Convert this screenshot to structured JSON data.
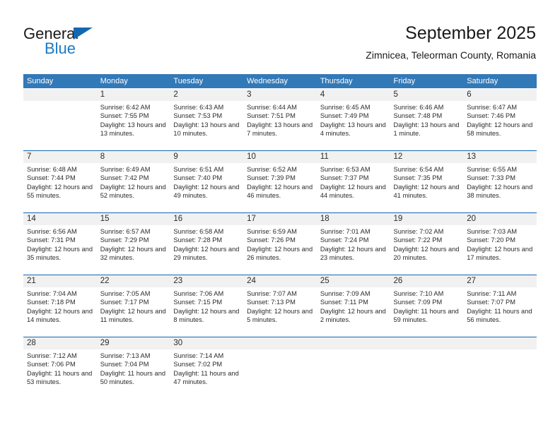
{
  "brand": {
    "name_part1": "General",
    "name_part2": "Blue",
    "triangle_color": "#1268b3",
    "blue_text_color": "#1b79c6"
  },
  "header": {
    "title": "September 2025",
    "subtitle": "Zimnicea, Teleorman County, Romania"
  },
  "theme": {
    "header_blue": "#3279b7",
    "separator_blue": "#1268b3",
    "daynum_band_gray": "#f1f1f1",
    "text_color": "#2b2b2b"
  },
  "weekday_headers": [
    "Sunday",
    "Monday",
    "Tuesday",
    "Wednesday",
    "Thursday",
    "Friday",
    "Saturday"
  ],
  "labels": {
    "sunrise_prefix": "Sunrise: ",
    "sunset_prefix": "Sunset: ",
    "daylight_prefix": "Daylight: "
  },
  "weeks": [
    {
      "days": [
        {
          "num": "",
          "sunrise": "",
          "sunset": "",
          "daylight": "",
          "empty": true
        },
        {
          "num": "1",
          "sunrise": "Sunrise: 6:42 AM",
          "sunset": "Sunset: 7:55 PM",
          "daylight": "Daylight: 13 hours and 13 minutes.",
          "empty": false
        },
        {
          "num": "2",
          "sunrise": "Sunrise: 6:43 AM",
          "sunset": "Sunset: 7:53 PM",
          "daylight": "Daylight: 13 hours and 10 minutes.",
          "empty": false
        },
        {
          "num": "3",
          "sunrise": "Sunrise: 6:44 AM",
          "sunset": "Sunset: 7:51 PM",
          "daylight": "Daylight: 13 hours and 7 minutes.",
          "empty": false
        },
        {
          "num": "4",
          "sunrise": "Sunrise: 6:45 AM",
          "sunset": "Sunset: 7:49 PM",
          "daylight": "Daylight: 13 hours and 4 minutes.",
          "empty": false
        },
        {
          "num": "5",
          "sunrise": "Sunrise: 6:46 AM",
          "sunset": "Sunset: 7:48 PM",
          "daylight": "Daylight: 13 hours and 1 minute.",
          "empty": false
        },
        {
          "num": "6",
          "sunrise": "Sunrise: 6:47 AM",
          "sunset": "Sunset: 7:46 PM",
          "daylight": "Daylight: 12 hours and 58 minutes.",
          "empty": false
        }
      ]
    },
    {
      "days": [
        {
          "num": "7",
          "sunrise": "Sunrise: 6:48 AM",
          "sunset": "Sunset: 7:44 PM",
          "daylight": "Daylight: 12 hours and 55 minutes.",
          "empty": false
        },
        {
          "num": "8",
          "sunrise": "Sunrise: 6:49 AM",
          "sunset": "Sunset: 7:42 PM",
          "daylight": "Daylight: 12 hours and 52 minutes.",
          "empty": false
        },
        {
          "num": "9",
          "sunrise": "Sunrise: 6:51 AM",
          "sunset": "Sunset: 7:40 PM",
          "daylight": "Daylight: 12 hours and 49 minutes.",
          "empty": false
        },
        {
          "num": "10",
          "sunrise": "Sunrise: 6:52 AM",
          "sunset": "Sunset: 7:39 PM",
          "daylight": "Daylight: 12 hours and 46 minutes.",
          "empty": false
        },
        {
          "num": "11",
          "sunrise": "Sunrise: 6:53 AM",
          "sunset": "Sunset: 7:37 PM",
          "daylight": "Daylight: 12 hours and 44 minutes.",
          "empty": false
        },
        {
          "num": "12",
          "sunrise": "Sunrise: 6:54 AM",
          "sunset": "Sunset: 7:35 PM",
          "daylight": "Daylight: 12 hours and 41 minutes.",
          "empty": false
        },
        {
          "num": "13",
          "sunrise": "Sunrise: 6:55 AM",
          "sunset": "Sunset: 7:33 PM",
          "daylight": "Daylight: 12 hours and 38 minutes.",
          "empty": false
        }
      ]
    },
    {
      "days": [
        {
          "num": "14",
          "sunrise": "Sunrise: 6:56 AM",
          "sunset": "Sunset: 7:31 PM",
          "daylight": "Daylight: 12 hours and 35 minutes.",
          "empty": false
        },
        {
          "num": "15",
          "sunrise": "Sunrise: 6:57 AM",
          "sunset": "Sunset: 7:29 PM",
          "daylight": "Daylight: 12 hours and 32 minutes.",
          "empty": false
        },
        {
          "num": "16",
          "sunrise": "Sunrise: 6:58 AM",
          "sunset": "Sunset: 7:28 PM",
          "daylight": "Daylight: 12 hours and 29 minutes.",
          "empty": false
        },
        {
          "num": "17",
          "sunrise": "Sunrise: 6:59 AM",
          "sunset": "Sunset: 7:26 PM",
          "daylight": "Daylight: 12 hours and 26 minutes.",
          "empty": false
        },
        {
          "num": "18",
          "sunrise": "Sunrise: 7:01 AM",
          "sunset": "Sunset: 7:24 PM",
          "daylight": "Daylight: 12 hours and 23 minutes.",
          "empty": false
        },
        {
          "num": "19",
          "sunrise": "Sunrise: 7:02 AM",
          "sunset": "Sunset: 7:22 PM",
          "daylight": "Daylight: 12 hours and 20 minutes.",
          "empty": false
        },
        {
          "num": "20",
          "sunrise": "Sunrise: 7:03 AM",
          "sunset": "Sunset: 7:20 PM",
          "daylight": "Daylight: 12 hours and 17 minutes.",
          "empty": false
        }
      ]
    },
    {
      "days": [
        {
          "num": "21",
          "sunrise": "Sunrise: 7:04 AM",
          "sunset": "Sunset: 7:18 PM",
          "daylight": "Daylight: 12 hours and 14 minutes.",
          "empty": false
        },
        {
          "num": "22",
          "sunrise": "Sunrise: 7:05 AM",
          "sunset": "Sunset: 7:17 PM",
          "daylight": "Daylight: 12 hours and 11 minutes.",
          "empty": false
        },
        {
          "num": "23",
          "sunrise": "Sunrise: 7:06 AM",
          "sunset": "Sunset: 7:15 PM",
          "daylight": "Daylight: 12 hours and 8 minutes.",
          "empty": false
        },
        {
          "num": "24",
          "sunrise": "Sunrise: 7:07 AM",
          "sunset": "Sunset: 7:13 PM",
          "daylight": "Daylight: 12 hours and 5 minutes.",
          "empty": false
        },
        {
          "num": "25",
          "sunrise": "Sunrise: 7:09 AM",
          "sunset": "Sunset: 7:11 PM",
          "daylight": "Daylight: 12 hours and 2 minutes.",
          "empty": false
        },
        {
          "num": "26",
          "sunrise": "Sunrise: 7:10 AM",
          "sunset": "Sunset: 7:09 PM",
          "daylight": "Daylight: 11 hours and 59 minutes.",
          "empty": false
        },
        {
          "num": "27",
          "sunrise": "Sunrise: 7:11 AM",
          "sunset": "Sunset: 7:07 PM",
          "daylight": "Daylight: 11 hours and 56 minutes.",
          "empty": false
        }
      ]
    },
    {
      "days": [
        {
          "num": "28",
          "sunrise": "Sunrise: 7:12 AM",
          "sunset": "Sunset: 7:06 PM",
          "daylight": "Daylight: 11 hours and 53 minutes.",
          "empty": false
        },
        {
          "num": "29",
          "sunrise": "Sunrise: 7:13 AM",
          "sunset": "Sunset: 7:04 PM",
          "daylight": "Daylight: 11 hours and 50 minutes.",
          "empty": false
        },
        {
          "num": "30",
          "sunrise": "Sunrise: 7:14 AM",
          "sunset": "Sunset: 7:02 PM",
          "daylight": "Daylight: 11 hours and 47 minutes.",
          "empty": false
        },
        {
          "num": "",
          "sunrise": "",
          "sunset": "",
          "daylight": "",
          "empty": true
        },
        {
          "num": "",
          "sunrise": "",
          "sunset": "",
          "daylight": "",
          "empty": true
        },
        {
          "num": "",
          "sunrise": "",
          "sunset": "",
          "daylight": "",
          "empty": true
        },
        {
          "num": "",
          "sunrise": "",
          "sunset": "",
          "daylight": "",
          "empty": true
        }
      ]
    }
  ]
}
